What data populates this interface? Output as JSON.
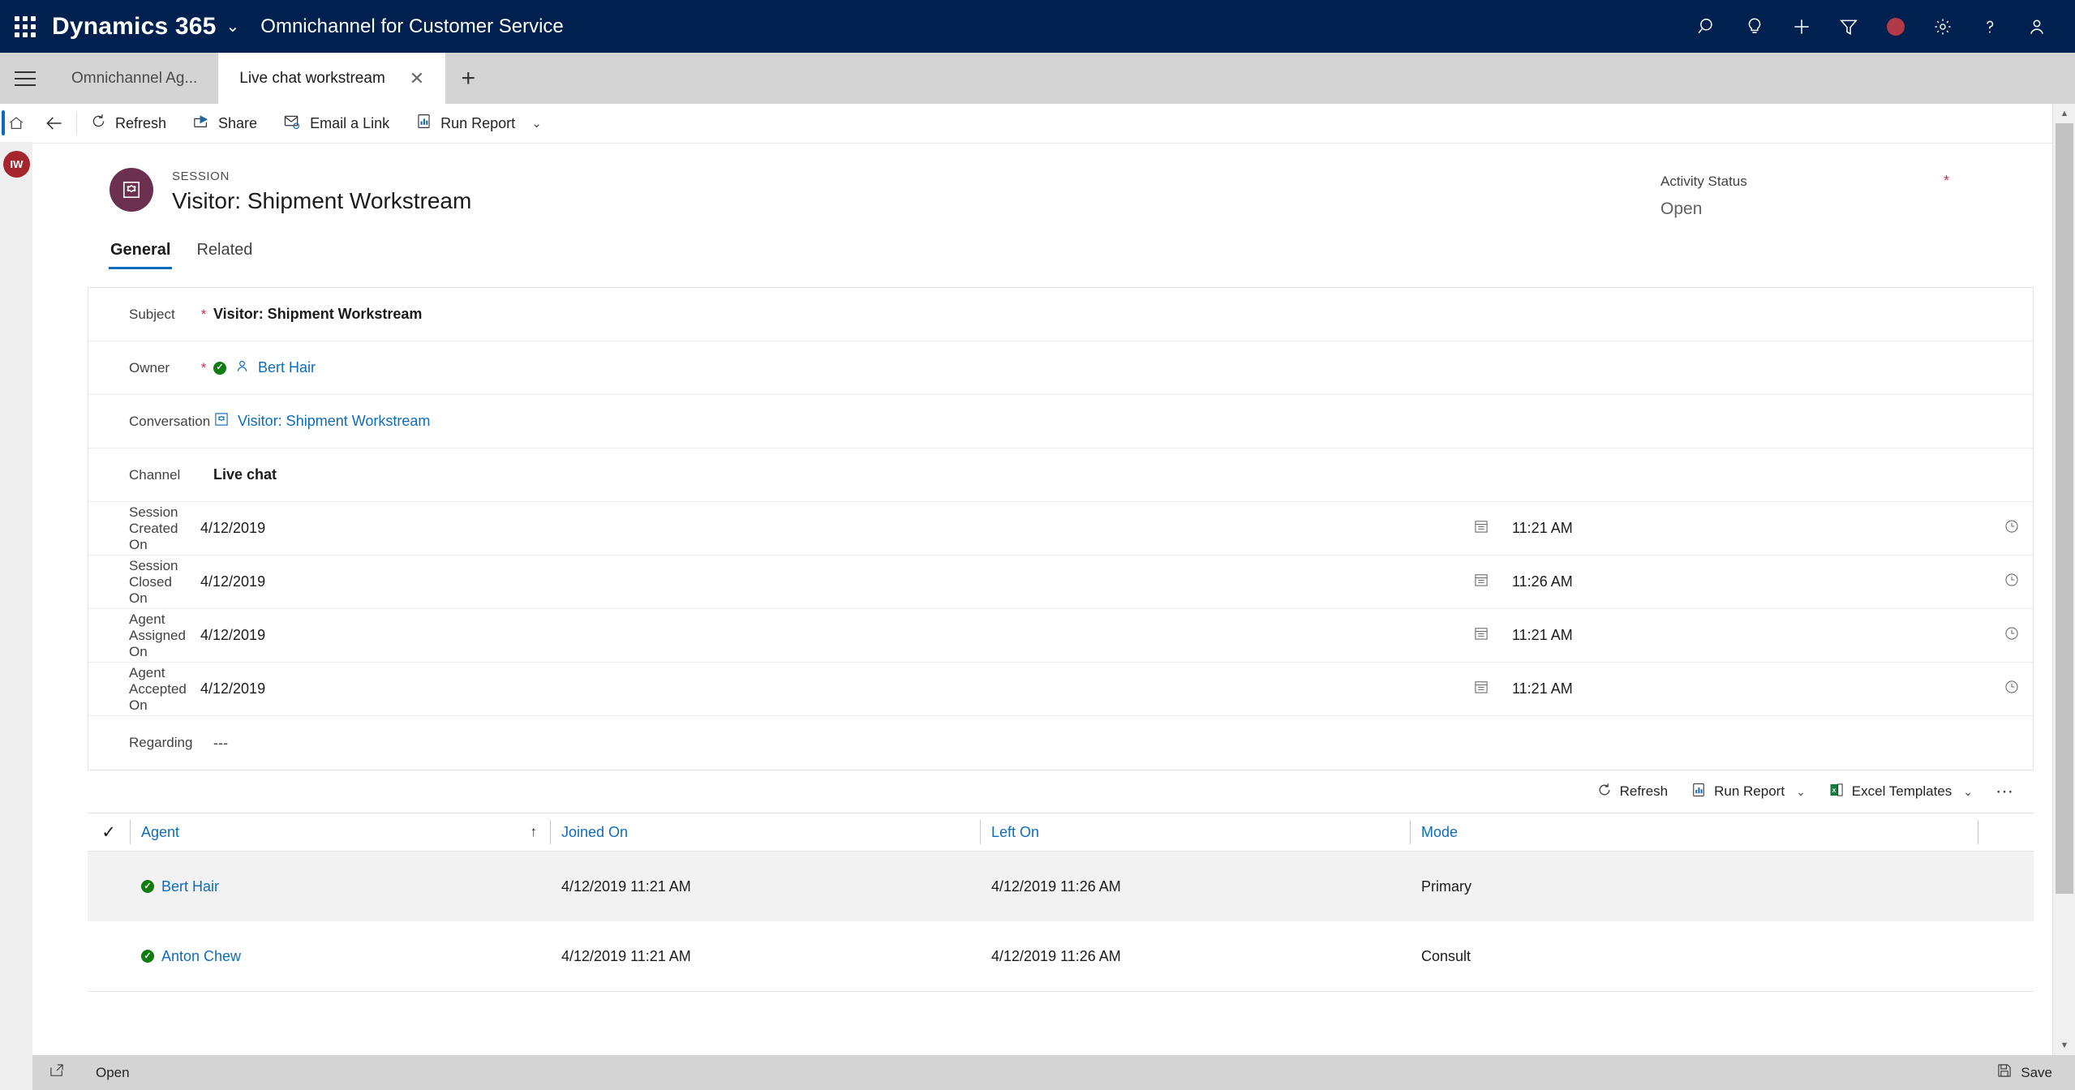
{
  "topbar": {
    "waffle_label": "app-launcher",
    "brand": "Dynamics 365",
    "brand_chevron": "⌄",
    "app_name": "Omnichannel for Customer Service",
    "icons": [
      {
        "name": "search-icon",
        "title": "Search"
      },
      {
        "name": "lightbulb-icon",
        "title": "Assistant"
      },
      {
        "name": "plus-icon",
        "title": "Quick Create"
      },
      {
        "name": "filter-icon",
        "title": "Filter"
      },
      {
        "name": "record-status-icon",
        "title": "Presence",
        "color": "#b23a48"
      },
      {
        "name": "gear-icon",
        "title": "Settings"
      },
      {
        "name": "help-icon",
        "title": "Help"
      },
      {
        "name": "user-icon",
        "title": "Account"
      }
    ]
  },
  "tabs": {
    "items": [
      {
        "label": "Omnichannel Ag...",
        "active": false,
        "closable": false
      },
      {
        "label": "Live chat workstream",
        "active": true,
        "closable": true
      }
    ],
    "close_glyph": "✕",
    "add_glyph": "+"
  },
  "leftrail": {
    "home_label": "home-icon",
    "avatar_initials": "IW"
  },
  "commandbar": {
    "back_label": "Back",
    "buttons": [
      {
        "label": "Refresh",
        "icon": "refresh-icon"
      },
      {
        "label": "Share",
        "icon": "share-icon"
      },
      {
        "label": "Email a Link",
        "icon": "email-link-icon"
      },
      {
        "label": "Run Report",
        "icon": "run-report-icon",
        "caret": true
      }
    ],
    "caret_glyph": "⌄"
  },
  "record": {
    "eyebrow": "SESSION",
    "title": "Visitor: Shipment Workstream",
    "icon_color": "#6b3050",
    "header_field": {
      "label": "Activity Status",
      "required_glyph": "*",
      "value": "Open"
    }
  },
  "form_tabs": [
    {
      "label": "General",
      "active": true
    },
    {
      "label": "Related",
      "active": false
    }
  ],
  "fields": [
    {
      "label": "Subject",
      "required": true,
      "type": "text",
      "value": "Visitor: Shipment Workstream",
      "bold": true
    },
    {
      "label": "Owner",
      "required": true,
      "type": "lookup-user",
      "value": "Bert Hair"
    },
    {
      "label": "Conversation",
      "required": false,
      "type": "lookup-entity",
      "value": "Visitor: Shipment Workstream"
    },
    {
      "label": "Channel",
      "required": false,
      "type": "text",
      "value": "Live chat",
      "bold": true
    },
    {
      "label": "Session Created On",
      "required": false,
      "type": "datetime",
      "date": "4/12/2019",
      "time": "11:21 AM"
    },
    {
      "label": "Session Closed On",
      "required": false,
      "type": "datetime",
      "date": "4/12/2019",
      "time": "11:26 AM"
    },
    {
      "label": "Agent Assigned On",
      "required": false,
      "type": "datetime",
      "date": "4/12/2019",
      "time": "11:21 AM"
    },
    {
      "label": "Agent Accepted On",
      "required": false,
      "type": "datetime",
      "date": "4/12/2019",
      "time": "11:21 AM"
    },
    {
      "label": "Regarding",
      "required": false,
      "type": "text",
      "value": "---"
    }
  ],
  "subgrid": {
    "toolbar": [
      {
        "label": "Refresh",
        "icon": "refresh-icon",
        "caret": false
      },
      {
        "label": "Run Report",
        "icon": "run-report-icon",
        "caret": true
      },
      {
        "label": "Excel Templates",
        "icon": "excel-icon",
        "caret": true
      }
    ],
    "overflow_glyph": "⋯",
    "caret_glyph": "⌄",
    "select_all_glyph": "✓",
    "sort_glyph": "↑",
    "columns": [
      {
        "label": "Agent",
        "sorted": true
      },
      {
        "label": "Joined On",
        "sorted": false
      },
      {
        "label": "Left On",
        "sorted": false
      },
      {
        "label": "Mode",
        "sorted": false
      }
    ],
    "rows": [
      {
        "agent": "Bert Hair",
        "joined_on": "4/12/2019 11:21 AM",
        "left_on": "4/12/2019 11:26 AM",
        "mode": "Primary"
      },
      {
        "agent": "Anton Chew",
        "joined_on": "4/12/2019 11:21 AM",
        "left_on": "4/12/2019 11:26 AM",
        "mode": "Consult"
      }
    ]
  },
  "statusbar": {
    "open_label": "Open",
    "open_icon": "open-popout-icon",
    "save_label": "Save",
    "save_icon": "save-icon"
  },
  "scrollbar": {
    "up_glyph": "▲",
    "down_glyph": "▼"
  },
  "colors": {
    "nav_background": "#002050",
    "accent": "#0f6cbd",
    "required": "#c4314b",
    "valid": "#107c10",
    "entity_icon": "#6b3050",
    "avatar": "#a4262c"
  }
}
